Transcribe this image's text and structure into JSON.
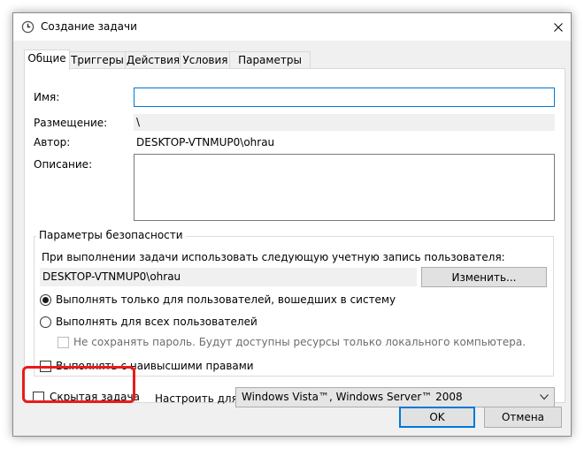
{
  "window": {
    "title": "Создание задачи",
    "icons": {
      "app": "clock-icon",
      "close": "close-icon"
    }
  },
  "tabs": [
    {
      "label": "Общие",
      "active": true
    },
    {
      "label": "Триггеры",
      "active": false
    },
    {
      "label": "Действия",
      "active": false
    },
    {
      "label": "Условия",
      "active": false
    },
    {
      "label": "Параметры",
      "active": false
    }
  ],
  "general": {
    "name_label": "Имя:",
    "name_value": "",
    "location_label": "Размещение:",
    "location_value": "\\",
    "author_label": "Автор:",
    "author_value": "DESKTOP-VTNMUP0\\ohrau",
    "description_label": "Описание:",
    "description_value": ""
  },
  "security": {
    "legend": "Параметры безопасности",
    "account_prompt": "При выполнении задачи использовать следующую учетную запись пользователя:",
    "account_value": "DESKTOP-VTNMUP0\\ohrau",
    "change_button": "Изменить...",
    "radio_logged_on": {
      "label": "Выполнять только для пользователей, вошедших в систему",
      "checked": true
    },
    "radio_all_users": {
      "label": "Выполнять для всех пользователей",
      "checked": false
    },
    "no_store_password": {
      "label": "Не сохранять пароль. Будут доступны ресурсы только локального компьютера.",
      "checked": false,
      "enabled": false
    },
    "highest_privileges": {
      "label": "Выполнять с наивысшими правами",
      "checked": false
    }
  },
  "hidden_task": {
    "label": "Скрытая задача",
    "checked": false
  },
  "configure": {
    "label": "Настроить для:",
    "selected": "Windows Vista™, Windows Server™ 2008"
  },
  "footer": {
    "ok_button": "OK",
    "cancel_button": "Отмена"
  },
  "colors": {
    "highlight": "#e81c1c",
    "focus": "#0078d7"
  }
}
